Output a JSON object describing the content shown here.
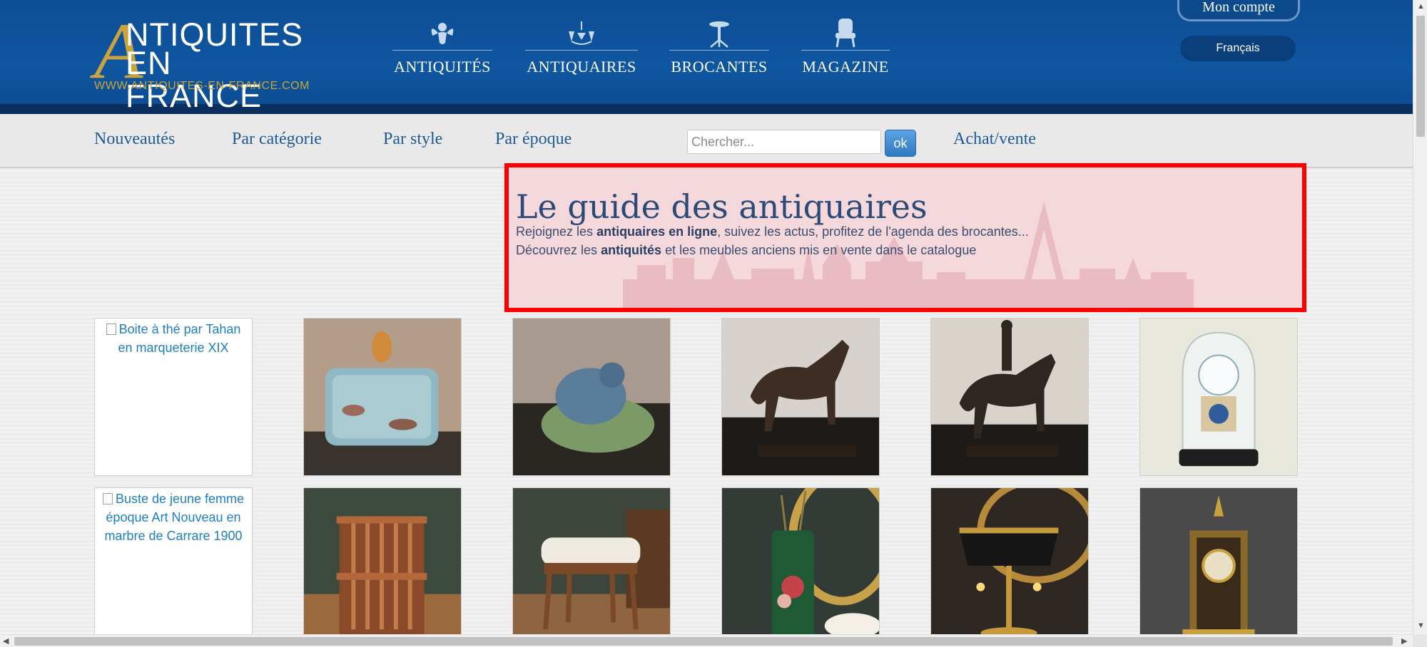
{
  "logo": {
    "big_letter": "A",
    "line1": "NTIQUITES",
    "line2": "EN FRANCE",
    "url": "WWW.ANTIQUITES-EN-FRANCE.COM"
  },
  "top_nav": [
    {
      "label": "ANTIQUITÉS",
      "icon": "cherub-icon"
    },
    {
      "label": "ANTIQUAIRES",
      "icon": "chandelier-icon"
    },
    {
      "label": "BROCANTES",
      "icon": "gueridon-table-icon"
    },
    {
      "label": "MAGAZINE",
      "icon": "armchair-icon"
    }
  ],
  "account": {
    "label": "Mon compte"
  },
  "language": {
    "label": "Français"
  },
  "sub_nav": {
    "nouveautes": "Nouveautés",
    "categorie": "Par catégorie",
    "style": "Par style",
    "epoque": "Par époque",
    "achat_vente": "Achat/vente"
  },
  "search": {
    "placeholder": "Chercher...",
    "button": "ok"
  },
  "banner": {
    "title": "Le guide des antiquaires",
    "line1_before": "Rejoignez les ",
    "line1_bold": "antiquaires en ligne",
    "line1_after": ", suivez les actus, profitez de l'agenda des brocantes...",
    "line2_before": "Découvrez les ",
    "line2_bold": "antiquités",
    "line2_after": " et les meubles anciens mis en vente dans le catalogue"
  },
  "products": {
    "row1_alt": "Boite à thé par Tahan en marqueterie XIX",
    "row2_alt": "Buste de jeune femme époque Art Nouveau en marbre de Carrare 1900"
  },
  "colors": {
    "header_blue": "#0f56a1",
    "gold": "#c9a43c",
    "link_blue": "#1f5a96",
    "highlight_red": "#ff0000"
  }
}
